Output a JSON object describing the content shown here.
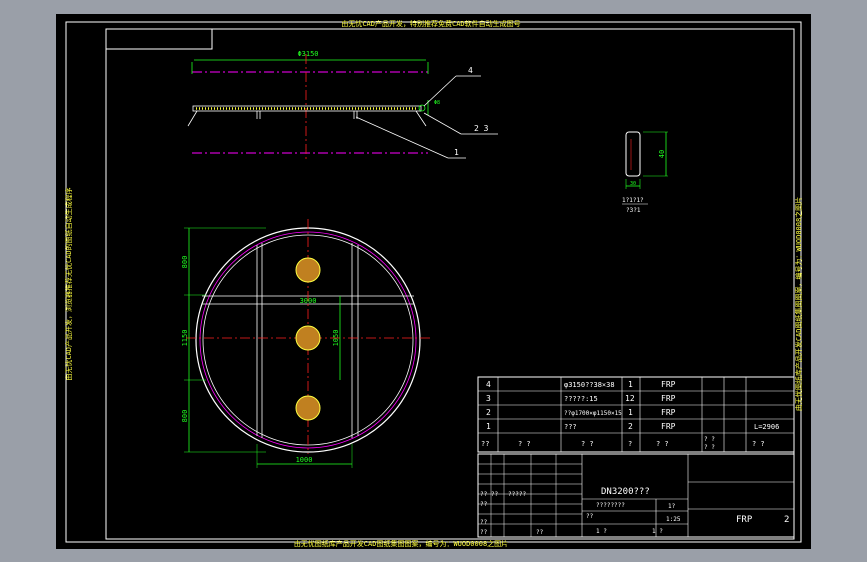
{
  "title_top": "由无忧CAD产品开发，特别推荐免费CAD软件自动生成图号",
  "title_bottom": "由无忧图纸库产品开发CAD图纸集图图案，编号为：WUOD0008之图片",
  "side_left": "由无忧CAD产品开发，浏览器推荐无忧CAD的图纸自动生成程序",
  "side_right": "由无忧图纸库产品开发CAD图纸集图图案，编号为：WUOD0008之图片",
  "callouts": {
    "c1": "1",
    "c23": "2 3",
    "c4": "4"
  },
  "dims": {
    "plan_width": "Φ3150",
    "side_small": "Φ8",
    "detail_height": "40",
    "detail_width": "30",
    "detail_note1": "1?1?1?",
    "detail_note2": "?3?1",
    "circle_v1": "800",
    "circle_v2": "1150",
    "circle_v3": "800",
    "circle_inner_v": "1050",
    "circle_mid_h": "3000",
    "circle_bottom": "1000"
  },
  "parts_rows": [
    {
      "no": "4",
      "spec": "φ3150??38×38",
      "qty": "1",
      "mat": "FRP"
    },
    {
      "no": "3",
      "spec": "?????:15",
      "qty": "12",
      "mat": "FRP"
    },
    {
      "no": "2",
      "spec": "??φ1700×φ1150×15",
      "qty": "1",
      "mat": "FRP"
    },
    {
      "no": "1",
      "spec": "???",
      "qty": "2",
      "mat": "FRP"
    }
  ],
  "parts_header": [
    "??",
    "?  ?",
    "?  ?",
    "?",
    "?  ?",
    "? ?",
    "? ?",
    "?  ?"
  ],
  "weight_note": "L=2906",
  "title_block": {
    "drawing_name": "DN3200???",
    "subtitle": "????????",
    "material": "FRP",
    "sheet": "2",
    "scale": "1:25",
    "scale_label": "1?",
    "labels": [
      "?? ??",
      "??",
      "?????",
      "??",
      "??",
      "??",
      "??",
      "1   ?",
      "1   ?"
    ]
  }
}
